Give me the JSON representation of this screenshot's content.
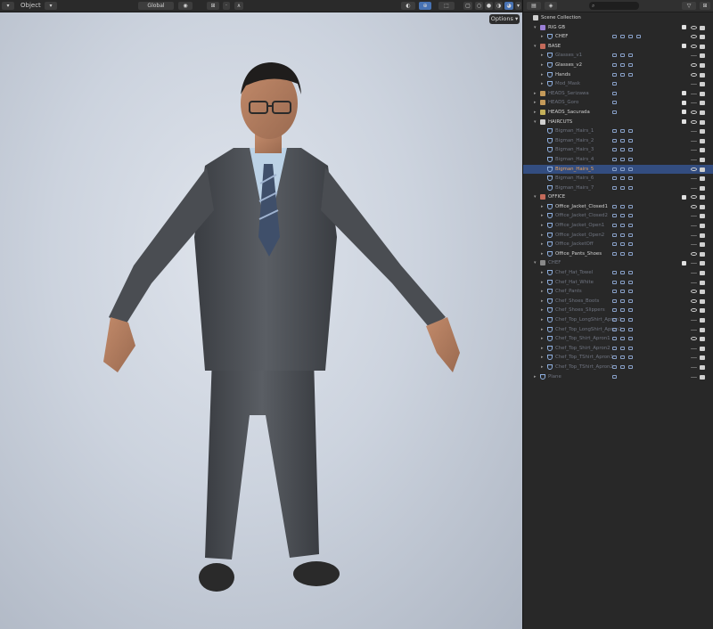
{
  "header": {
    "mode_label": "Object",
    "orientation_label": "Global",
    "options_label": "Options"
  },
  "outliner": {
    "rows": [
      {
        "label": "Scene Collection",
        "indent": 0,
        "type": "scene",
        "arrow": "",
        "dim": false,
        "hl": false,
        "sel": false,
        "chk": false,
        "eye": false,
        "cam": false,
        "extras": 0
      },
      {
        "label": "RIG GB",
        "indent": 1,
        "type": "coll",
        "color": "#9a7fd6",
        "arrow": "▾",
        "dim": false,
        "hl": false,
        "sel": false,
        "chk": true,
        "eye": "on",
        "cam": true,
        "extras": 0
      },
      {
        "label": "CHEF",
        "indent": 2,
        "type": "mesh",
        "arrow": "▸",
        "dim": false,
        "hl": false,
        "sel": false,
        "chk": false,
        "eye": "on",
        "cam": true,
        "extras": 4
      },
      {
        "label": "BASE",
        "indent": 1,
        "type": "coll",
        "color": "#c46a5a",
        "arrow": "▾",
        "dim": false,
        "hl": false,
        "sel": false,
        "chk": true,
        "eye": "on",
        "cam": true,
        "extras": 0
      },
      {
        "label": "Glasses_v1",
        "indent": 2,
        "type": "mesh",
        "arrow": "▸",
        "dim": true,
        "hl": false,
        "sel": false,
        "chk": false,
        "eye": "off",
        "cam": true,
        "extras": 3
      },
      {
        "label": "Glasses_v2",
        "indent": 2,
        "type": "mesh",
        "arrow": "▸",
        "dim": false,
        "hl": false,
        "sel": false,
        "chk": false,
        "eye": "on",
        "cam": true,
        "extras": 3
      },
      {
        "label": "Hands",
        "indent": 2,
        "type": "mesh",
        "arrow": "▸",
        "dim": false,
        "hl": false,
        "sel": false,
        "chk": false,
        "eye": "on",
        "cam": true,
        "extras": 3
      },
      {
        "label": "Mod_Mask",
        "indent": 2,
        "type": "mesh",
        "arrow": "▸",
        "dim": true,
        "hl": false,
        "sel": false,
        "chk": false,
        "eye": "off",
        "cam": true,
        "extras": 1
      },
      {
        "label": "HEADS_Serizawa",
        "indent": 1,
        "type": "coll",
        "color": "#c49a5a",
        "arrow": "▸",
        "dim": true,
        "hl": false,
        "sel": false,
        "chk": true,
        "eye": "off",
        "cam": true,
        "extras": 1
      },
      {
        "label": "HEADS_Goro",
        "indent": 1,
        "type": "coll",
        "color": "#c49a5a",
        "arrow": "▸",
        "dim": true,
        "hl": false,
        "sel": false,
        "chk": true,
        "eye": "off",
        "cam": true,
        "extras": 1
      },
      {
        "label": "HEADS_Sacurada",
        "indent": 1,
        "type": "coll",
        "color": "#c4b05a",
        "arrow": "▸",
        "dim": false,
        "hl": false,
        "sel": false,
        "chk": true,
        "eye": "on",
        "cam": true,
        "extras": 1
      },
      {
        "label": "HAIRCUTS",
        "indent": 1,
        "type": "coll",
        "color": "#d0d0d0",
        "arrow": "▾",
        "dim": false,
        "hl": false,
        "sel": false,
        "chk": true,
        "eye": "on",
        "cam": true,
        "extras": 0
      },
      {
        "label": "Bigman_Hairs_1",
        "indent": 2,
        "type": "mesh",
        "arrow": "",
        "dim": true,
        "hl": false,
        "sel": false,
        "chk": false,
        "eye": "off",
        "cam": true,
        "extras": 3
      },
      {
        "label": "Bigman_Hairs_2",
        "indent": 2,
        "type": "mesh",
        "arrow": "",
        "dim": true,
        "hl": false,
        "sel": false,
        "chk": false,
        "eye": "off",
        "cam": true,
        "extras": 3
      },
      {
        "label": "Bigman_Hairs_3",
        "indent": 2,
        "type": "mesh",
        "arrow": "",
        "dim": true,
        "hl": false,
        "sel": false,
        "chk": false,
        "eye": "off",
        "cam": true,
        "extras": 3
      },
      {
        "label": "Bigman_Hairs_4",
        "indent": 2,
        "type": "mesh",
        "arrow": "",
        "dim": true,
        "hl": false,
        "sel": false,
        "chk": false,
        "eye": "off",
        "cam": true,
        "extras": 3
      },
      {
        "label": "Bigman_Hairs_5",
        "indent": 2,
        "type": "mesh",
        "arrow": "",
        "dim": false,
        "hl": true,
        "sel": true,
        "chk": false,
        "eye": "on",
        "cam": true,
        "extras": 3
      },
      {
        "label": "Bigman_Hairs_6",
        "indent": 2,
        "type": "mesh",
        "arrow": "",
        "dim": true,
        "hl": false,
        "sel": false,
        "chk": false,
        "eye": "off",
        "cam": true,
        "extras": 3
      },
      {
        "label": "Bigman_Hairs_7",
        "indent": 2,
        "type": "mesh",
        "arrow": "",
        "dim": true,
        "hl": false,
        "sel": false,
        "chk": false,
        "eye": "off",
        "cam": true,
        "extras": 3
      },
      {
        "label": "OFFICE",
        "indent": 1,
        "type": "coll",
        "color": "#c46a5a",
        "arrow": "▾",
        "dim": false,
        "hl": false,
        "sel": false,
        "chk": true,
        "eye": "on",
        "cam": true,
        "extras": 0
      },
      {
        "label": "Office_Jacket_Closed1",
        "indent": 2,
        "type": "mesh",
        "arrow": "▸",
        "dim": false,
        "hl": false,
        "sel": false,
        "chk": false,
        "eye": "on",
        "cam": true,
        "extras": 3
      },
      {
        "label": "Office_Jacket_Closed2",
        "indent": 2,
        "type": "mesh",
        "arrow": "▸",
        "dim": true,
        "hl": false,
        "sel": false,
        "chk": false,
        "eye": "off",
        "cam": true,
        "extras": 3
      },
      {
        "label": "Office_Jacket_Open1",
        "indent": 2,
        "type": "mesh",
        "arrow": "▸",
        "dim": true,
        "hl": false,
        "sel": false,
        "chk": false,
        "eye": "off",
        "cam": true,
        "extras": 3
      },
      {
        "label": "Office_Jacket_Open2",
        "indent": 2,
        "type": "mesh",
        "arrow": "▸",
        "dim": true,
        "hl": false,
        "sel": false,
        "chk": false,
        "eye": "off",
        "cam": true,
        "extras": 3
      },
      {
        "label": "Office_JacketOff",
        "indent": 2,
        "type": "mesh",
        "arrow": "▸",
        "dim": true,
        "hl": false,
        "sel": false,
        "chk": false,
        "eye": "off",
        "cam": true,
        "extras": 3
      },
      {
        "label": "Office_Pants_Shoes",
        "indent": 2,
        "type": "mesh",
        "arrow": "▸",
        "dim": false,
        "hl": false,
        "sel": false,
        "chk": false,
        "eye": "on",
        "cam": true,
        "extras": 3
      },
      {
        "label": "CHEF",
        "indent": 1,
        "type": "coll",
        "color": "#8a8a8a",
        "arrow": "▾",
        "dim": true,
        "hl": false,
        "sel": false,
        "chk": true,
        "eye": "off",
        "cam": true,
        "extras": 0
      },
      {
        "label": "Chef_Hat_Towel",
        "indent": 2,
        "type": "mesh",
        "arrow": "▸",
        "dim": true,
        "hl": false,
        "sel": false,
        "chk": false,
        "eye": "off",
        "cam": true,
        "extras": 3
      },
      {
        "label": "Chef_Hat_White",
        "indent": 2,
        "type": "mesh",
        "arrow": "▸",
        "dim": true,
        "hl": false,
        "sel": false,
        "chk": false,
        "eye": "off",
        "cam": true,
        "extras": 3
      },
      {
        "label": "Chef_Pants",
        "indent": 2,
        "type": "mesh",
        "arrow": "▸",
        "dim": true,
        "hl": false,
        "sel": false,
        "chk": false,
        "eye": "on",
        "cam": true,
        "extras": 3
      },
      {
        "label": "Chef_Shoes_Boots",
        "indent": 2,
        "type": "mesh",
        "arrow": "▸",
        "dim": true,
        "hl": false,
        "sel": false,
        "chk": false,
        "eye": "on",
        "cam": true,
        "extras": 3
      },
      {
        "label": "Chef_Shoes_Slippers",
        "indent": 2,
        "type": "mesh",
        "arrow": "▸",
        "dim": true,
        "hl": false,
        "sel": false,
        "chk": false,
        "eye": "on",
        "cam": true,
        "extras": 3
      },
      {
        "label": "Chef_Top_LongShirt_Apron1",
        "indent": 2,
        "type": "mesh",
        "arrow": "▸",
        "dim": true,
        "hl": false,
        "sel": false,
        "chk": false,
        "eye": "off",
        "cam": true,
        "extras": 3
      },
      {
        "label": "Chef_Top_LongShirt_Apron2",
        "indent": 2,
        "type": "mesh",
        "arrow": "▸",
        "dim": true,
        "hl": false,
        "sel": false,
        "chk": false,
        "eye": "off",
        "cam": true,
        "extras": 3
      },
      {
        "label": "Chef_Top_Shirt_Apron1",
        "indent": 2,
        "type": "mesh",
        "arrow": "▸",
        "dim": true,
        "hl": false,
        "sel": false,
        "chk": false,
        "eye": "on",
        "cam": true,
        "extras": 3
      },
      {
        "label": "Chef_Top_Shirt_Apron2",
        "indent": 2,
        "type": "mesh",
        "arrow": "▸",
        "dim": true,
        "hl": false,
        "sel": false,
        "chk": false,
        "eye": "off",
        "cam": true,
        "extras": 3
      },
      {
        "label": "Chef_Top_TShirt_Apron1",
        "indent": 2,
        "type": "mesh",
        "arrow": "▸",
        "dim": true,
        "hl": false,
        "sel": false,
        "chk": false,
        "eye": "off",
        "cam": true,
        "extras": 3
      },
      {
        "label": "Chef_Top_TShirt_Apron2",
        "indent": 2,
        "type": "mesh",
        "arrow": "▸",
        "dim": true,
        "hl": false,
        "sel": false,
        "chk": false,
        "eye": "off",
        "cam": true,
        "extras": 3
      },
      {
        "label": "Plane",
        "indent": 1,
        "type": "mesh",
        "arrow": "▸",
        "dim": true,
        "hl": false,
        "sel": false,
        "chk": false,
        "eye": "off",
        "cam": true,
        "extras": 1
      }
    ]
  }
}
